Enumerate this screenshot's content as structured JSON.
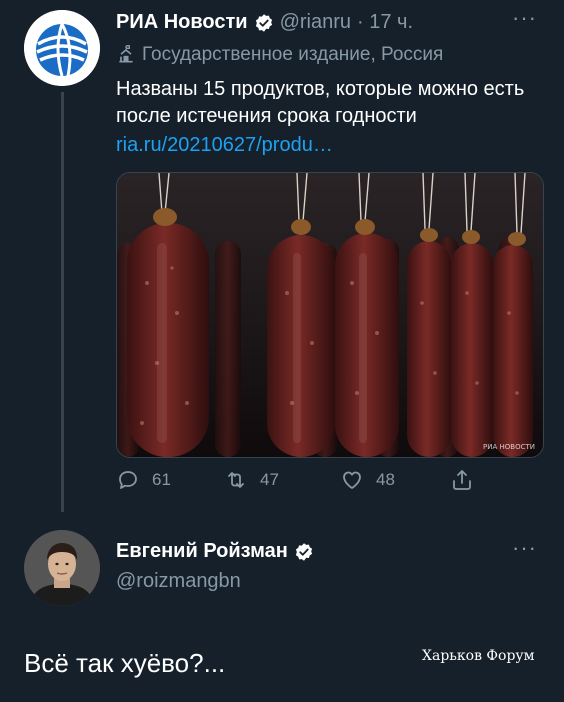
{
  "tweet_main": {
    "author_name": "РИА Новости",
    "handle": "@rianru",
    "time": "· 17 ч.",
    "label": "Государственное издание, Россия",
    "text": "Названы 15 продуктов, которые можно есть после истечения срока годности",
    "link": "ria.ru/20210627/produ…",
    "media_watermark": "РИА НОВОСТИ",
    "counts": {
      "replies": "61",
      "retweets": "47",
      "likes": "48"
    }
  },
  "tweet_reply": {
    "author_name": "Евгений Ройзман",
    "handle": "@roizmangbn",
    "text": "Всё так хуёво?..."
  },
  "overlay": {
    "forum_watermark": "Харьков Форум"
  },
  "colors": {
    "background": "#15202b",
    "secondary_text": "#8899a6",
    "link": "#1da1f2",
    "verified": "#ffffff",
    "divider": "#38444d"
  }
}
